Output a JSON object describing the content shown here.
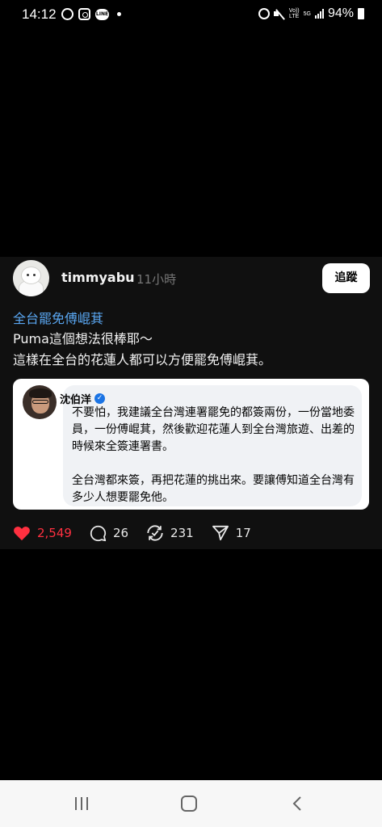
{
  "status_bar": {
    "time": "14:12",
    "network_vo": "Vo))",
    "network_lte": "LTE",
    "network_5g": "5G",
    "battery": "94%"
  },
  "post": {
    "username": "timmyabu",
    "time_ago": "11小時",
    "follow_label": "追蹤",
    "topic_tag": "全台罷免傅崐萁",
    "text_line1": "Puma這個想法很棒耶～",
    "text_line2": "這樣在全台的花蓮人都可以方便罷免傅崐萁。",
    "quote": {
      "author": "沈伯洋",
      "text": "不要怕，我建議全台灣連署罷免的都簽兩份，一份當地委員，一份傅崐萁，然後歡迎花蓮人到全台灣旅遊、出差的時候來全簽連署書。\n\n全台灣都來簽，再把花蓮的挑出來。要讓傅知道全台灣有多少人想要罷免他。"
    },
    "actions": {
      "likes": "2,549",
      "replies": "26",
      "reposts": "231",
      "shares": "17"
    }
  },
  "colors": {
    "like": "#ff3040",
    "topic": "#5aa7f2",
    "verified": "#1b74e4"
  }
}
